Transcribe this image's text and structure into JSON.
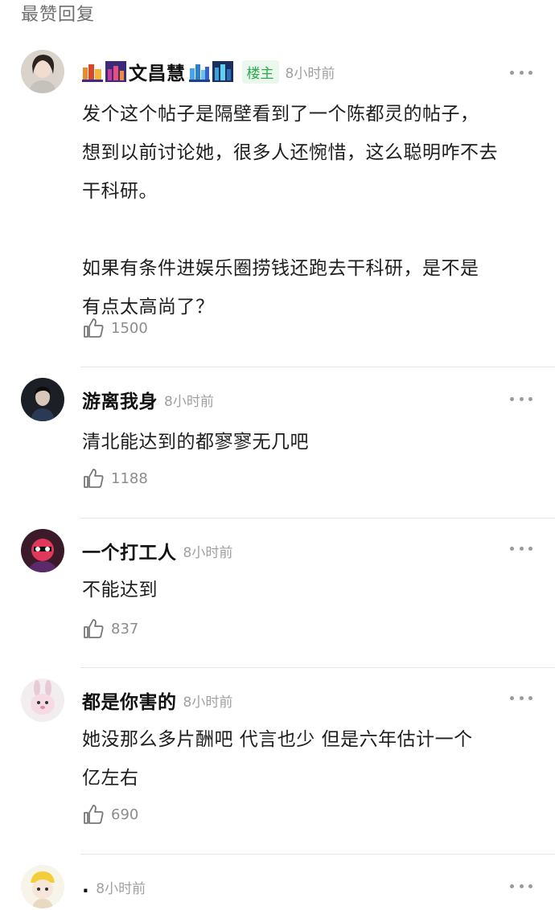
{
  "section_title": "最赞回复",
  "comments": [
    {
      "username": "文昌慧",
      "op_badge": "楼主",
      "time": "8小时前",
      "text": "发个这个帖子是隔壁看到了一个陈都灵的帖子，\n想到以前讨论她，很多人还惋惜，这么聪明咋不去\n干科研。\n\n如果有条件进娱乐圈捞钱还跑去干科研，是不是\n有点太高尚了？",
      "likes": "1500"
    },
    {
      "username": "游离我身",
      "time": "8小时前",
      "text": "清北能达到的都寥寥无几吧",
      "likes": "1188"
    },
    {
      "username": "一个打工人",
      "time": "8小时前",
      "text": "不能达到",
      "likes": "837"
    },
    {
      "username": "都是你害的",
      "time": "8小时前",
      "text": "她没那么多片酬吧 代言也少 但是六年估计一个\n亿左右",
      "likes": "690"
    },
    {
      "username": ".",
      "time": "8小时前"
    }
  ],
  "colors": {
    "op_badge": "#2fa84f",
    "meta": "#a0a0a0",
    "text": "#1e1e1e"
  },
  "icons": [
    "thumbs-up-icon",
    "more-dots-icon",
    "city-badge-icon"
  ]
}
